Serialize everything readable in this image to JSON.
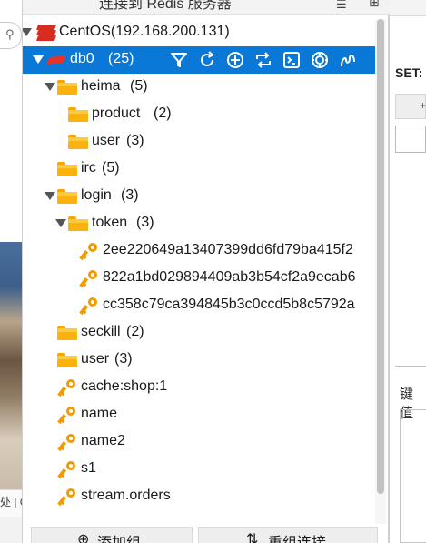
{
  "window": {
    "title": "连接到 Redis 服务器"
  },
  "background": {
    "right_label": "SET:",
    "right_kv_label": "键值",
    "left_photo_caption": "处 | C"
  },
  "tree": {
    "server": {
      "label": "CentOS(192.168.200.131)",
      "icon": "redis-logo-icon"
    },
    "db": {
      "label": "db0",
      "count": "(25)",
      "tools": [
        "filter-icon",
        "reload-icon",
        "add-key-icon",
        "refresh-icon",
        "console-icon",
        "server-info-icon",
        "lua-script-icon"
      ]
    },
    "rows": [
      {
        "name": "heima",
        "count": "(5)",
        "type": "folder",
        "expanded": true
      },
      {
        "name": "product",
        "count": "(2)",
        "type": "folder"
      },
      {
        "name": "user",
        "count": "(3)",
        "type": "folder"
      },
      {
        "name": "irc",
        "count": "(5)",
        "type": "folder"
      },
      {
        "name": "login",
        "count": "(3)",
        "type": "folder",
        "expanded": true
      },
      {
        "name": "token",
        "count": "(3)",
        "type": "folder",
        "expanded": true
      },
      {
        "name": "2ee220649a13407399dd6fd79ba415f2",
        "type": "key"
      },
      {
        "name": "822a1bd029894409ab3b54cf2a9ecab6",
        "type": "key"
      },
      {
        "name": "cc358c79ca394845b3c0ccd5b8c5792a",
        "type": "key"
      },
      {
        "name": "seckill",
        "count": "(2)",
        "type": "folder"
      },
      {
        "name": "user",
        "count": "(3)",
        "type": "folder"
      },
      {
        "name": "cache:shop:1",
        "type": "key"
      },
      {
        "name": "name",
        "type": "key"
      },
      {
        "name": "name2",
        "type": "key"
      },
      {
        "name": "s1",
        "type": "key"
      },
      {
        "name": "stream.orders",
        "type": "key"
      }
    ]
  },
  "buttons": {
    "add_group": "添加组",
    "reorder": "重组连接"
  },
  "colors": {
    "selection": "#0a78d7",
    "folder": "#fbb20f",
    "key": "#f39a00",
    "redis_red": "#d82c20"
  }
}
